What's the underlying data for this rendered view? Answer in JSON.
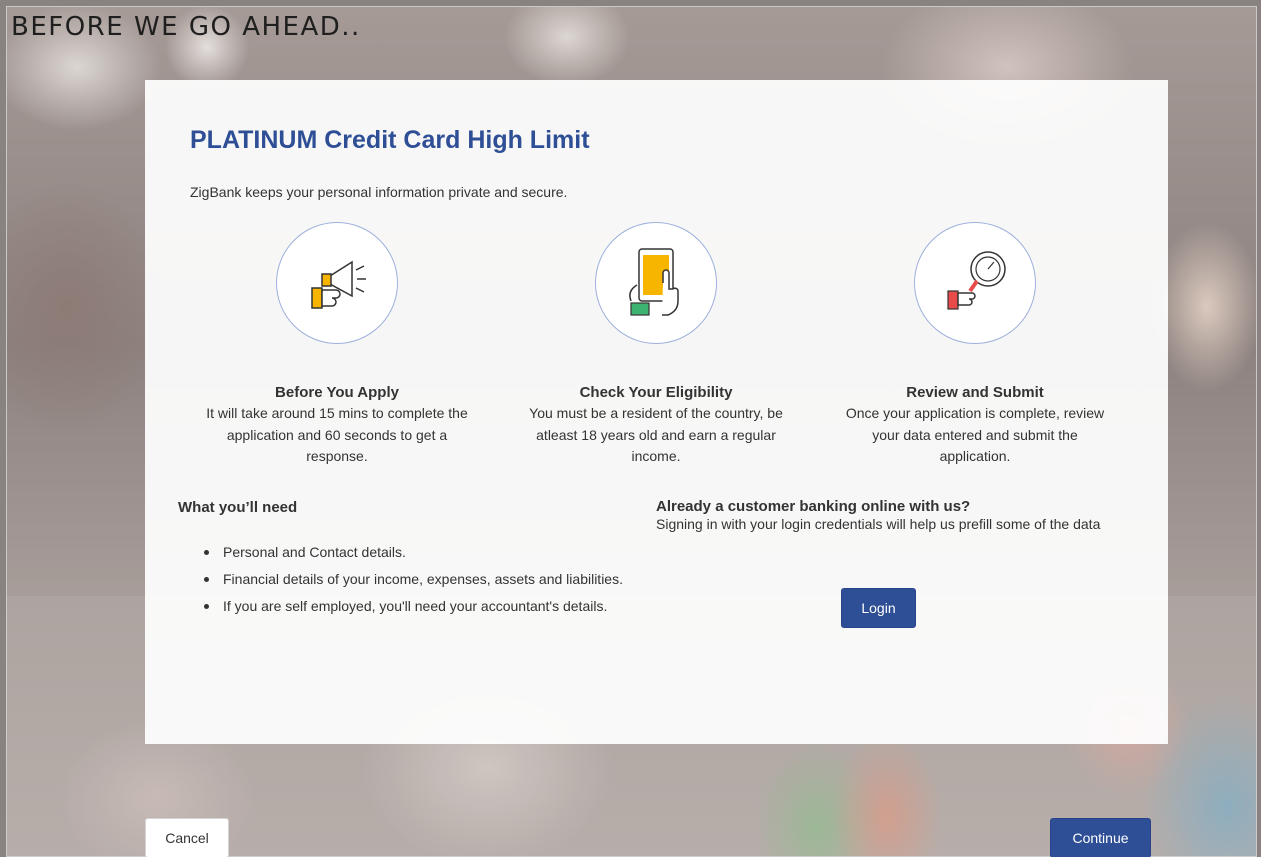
{
  "page": {
    "title": "BEFORE WE GO AHEAD.."
  },
  "card": {
    "title": "PLATINUM Credit Card High Limit",
    "privacy_text": "ZigBank keeps your personal information private and secure."
  },
  "steps": [
    {
      "icon": "megaphone-icon",
      "heading": "Before You Apply",
      "text": "It will take around 15 mins to complete the application and 60 seconds to get a response."
    },
    {
      "icon": "tablet-tap-icon",
      "heading": "Check Your Eligibility",
      "text": "You must be a resident of the country, be atleast 18 years old and earn a regular income."
    },
    {
      "icon": "magnifier-review-icon",
      "heading": "Review and Submit",
      "text": "Once your application is complete, review your data entered and submit the application."
    }
  ],
  "requirements": {
    "title": "What you’ll need",
    "items": [
      "Personal and Contact details.",
      "Financial details of your income, expenses, assets and liabilities.",
      "If you are self employed, you'll need your accountant's details."
    ]
  },
  "existing_customer": {
    "title": "Already a customer banking online with us?",
    "text": "Signing in with your login credentials will help us prefill some of the data",
    "login_label": "Login"
  },
  "footer": {
    "cancel_label": "Cancel",
    "continue_label": "Continue"
  },
  "colors": {
    "accent": "#2e4f96",
    "icon_yellow": "#f7b500",
    "icon_green": "#3cb371",
    "icon_red": "#e94b4b"
  }
}
